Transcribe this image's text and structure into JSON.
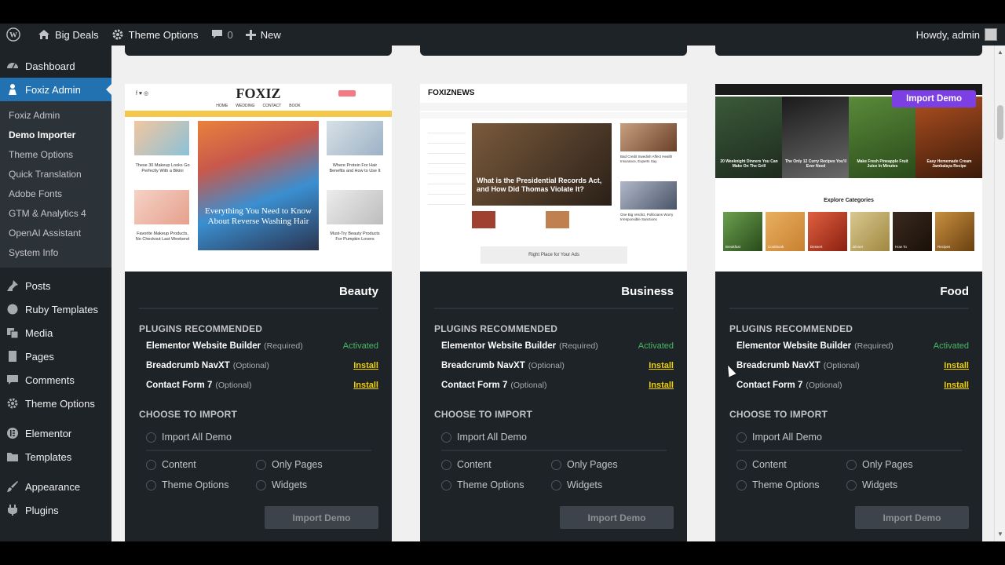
{
  "adminbar": {
    "site_name": "Big Deals",
    "theme_options": "Theme Options",
    "comments_count": "0",
    "new_label": "New",
    "howdy": "Howdy, admin"
  },
  "sidebar": {
    "items_top": [
      {
        "label": "Dashboard",
        "icon": "dashboard-icon"
      },
      {
        "label": "Foxiz Admin",
        "icon": "foxiz-icon"
      }
    ],
    "submenu": [
      "Foxiz Admin",
      "Demo Importer",
      "Theme Options",
      "Quick Translation",
      "Adobe Fonts",
      "GTM & Analytics 4",
      "OpenAI Assistant",
      "System Info"
    ],
    "items_bottom": [
      {
        "label": "Posts",
        "icon": "pin-icon"
      },
      {
        "label": "Ruby Templates",
        "icon": "ruby-icon"
      },
      {
        "label": "Media",
        "icon": "media-icon"
      },
      {
        "label": "Pages",
        "icon": "page-icon"
      },
      {
        "label": "Comments",
        "icon": "comment-icon"
      },
      {
        "label": "Theme Options",
        "icon": "gear-icon"
      },
      {
        "label": "Elementor",
        "icon": "elementor-icon"
      },
      {
        "label": "Templates",
        "icon": "folder-icon"
      },
      {
        "label": "Appearance",
        "icon": "brush-icon"
      },
      {
        "label": "Plugins",
        "icon": "plug-icon"
      }
    ]
  },
  "labels": {
    "plugins_recommended": "PLUGINS RECOMMENDED",
    "choose_to_import": "CHOOSE TO IMPORT",
    "import_all": "Import All Demo",
    "content": "Content",
    "only_pages": "Only Pages",
    "theme_options": "Theme Options",
    "widgets": "Widgets",
    "import_demo": "Import Demo"
  },
  "plugins": [
    {
      "name": "Elementor Website Builder",
      "tag": "(Required)",
      "status": "Activated"
    },
    {
      "name": "Breadcrumb NavXT",
      "tag": "(Optional)",
      "status": "Install"
    },
    {
      "name": "Contact Form 7",
      "tag": "(Optional)",
      "status": "Install"
    }
  ],
  "cards": [
    {
      "title": "Beauty",
      "preview": {
        "logo": "FOXIZ",
        "nav": [
          "HOME",
          "WEDDING",
          "CONTACT",
          "BOOK"
        ],
        "hero": "Everything You Need to Know About Reverse Washing Hair",
        "side": [
          "These 30 Makeup Looks Go Perfectly With a Bikini",
          "Where Protein For Hair Benefits and How to Use It",
          "Favorite Makeup Products, No Checkout Last Weekend",
          "Must-Try Beauty Products For Pumpkin Lovers"
        ]
      }
    },
    {
      "title": "Business",
      "preview": {
        "logo": "FOXIZNEWS",
        "hero": "What is the Presidential Records Act, and How Did Thomas Violate It?",
        "side": [
          "Bad Credit Swedish Affect Health Insurance, Experts Say",
          "One Big Verdict, Politicians Worry Irresponsible Sanctions"
        ],
        "ad": "Right Place for Your Ads"
      }
    },
    {
      "title": "Food",
      "preview": {
        "import_overlay": "Import Demo",
        "explore": "Explore Categories",
        "slides": [
          "20 Weeknight Dinners You Can Make On The Grill",
          "The Only 12 Curry Recipes You'll Ever Need",
          "Make Fresh Pineapple Fruit Juice In Minutes",
          "Easy Homemade Cream Jambalaya Recipe"
        ],
        "categories": [
          "Breakfast",
          "Cookbook",
          "Dessert",
          "Dinner",
          "How To",
          "Recipes"
        ]
      }
    }
  ],
  "colors": {
    "wp_dark": "#1d2327",
    "wp_blue": "#2271b1",
    "activated": "#4ab866",
    "install": "#f0d000",
    "overlay": "#7b3fe4"
  }
}
